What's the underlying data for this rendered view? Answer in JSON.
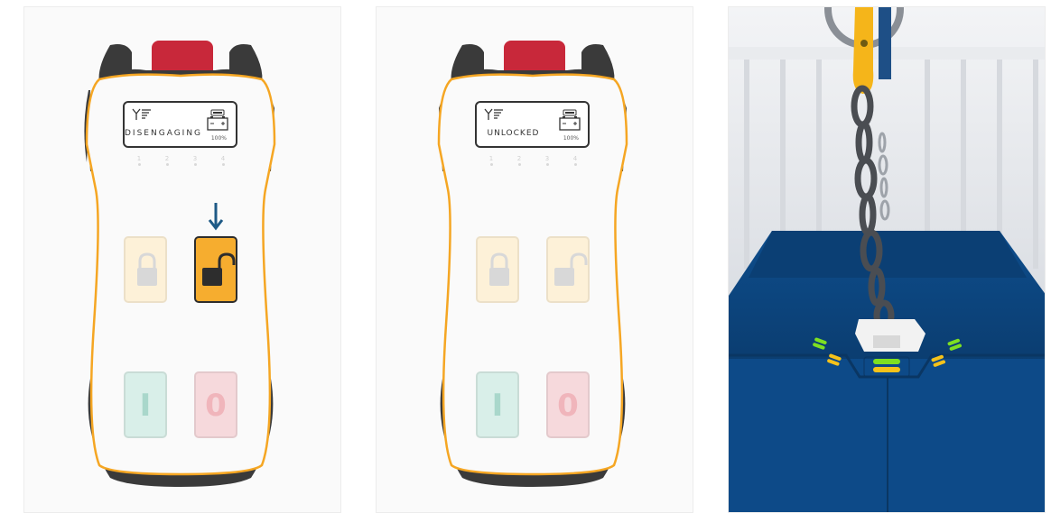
{
  "panels": [
    {
      "lcd": {
        "status": "DISENGAGING",
        "battery_pct": "100%"
      },
      "channels": [
        "1",
        "2",
        "3",
        "4"
      ],
      "buttons": {
        "on_glyph": "I",
        "off_glyph": "0"
      },
      "active_button": "unlock"
    },
    {
      "lcd": {
        "status": "UNLOCKED",
        "battery_pct": "100%"
      },
      "channels": [
        "1",
        "2",
        "3",
        "4"
      ],
      "buttons": {
        "on_glyph": "I",
        "off_glyph": "0"
      },
      "active_button": "none"
    }
  ],
  "colors": {
    "remote_frame": "#3a3a3a",
    "remote_outline": "#f5a623",
    "stop_button": "#c8283a",
    "unlock_active": "#f6ad2f",
    "arrow": "#1e5a86",
    "container_blue": "#0f4a86",
    "chain": "#4a4d52",
    "hook": "#f5b51a"
  },
  "icons": [
    "signal-icon",
    "battery-icon",
    "lock-closed-icon",
    "lock-open-icon",
    "down-arrow-icon"
  ]
}
